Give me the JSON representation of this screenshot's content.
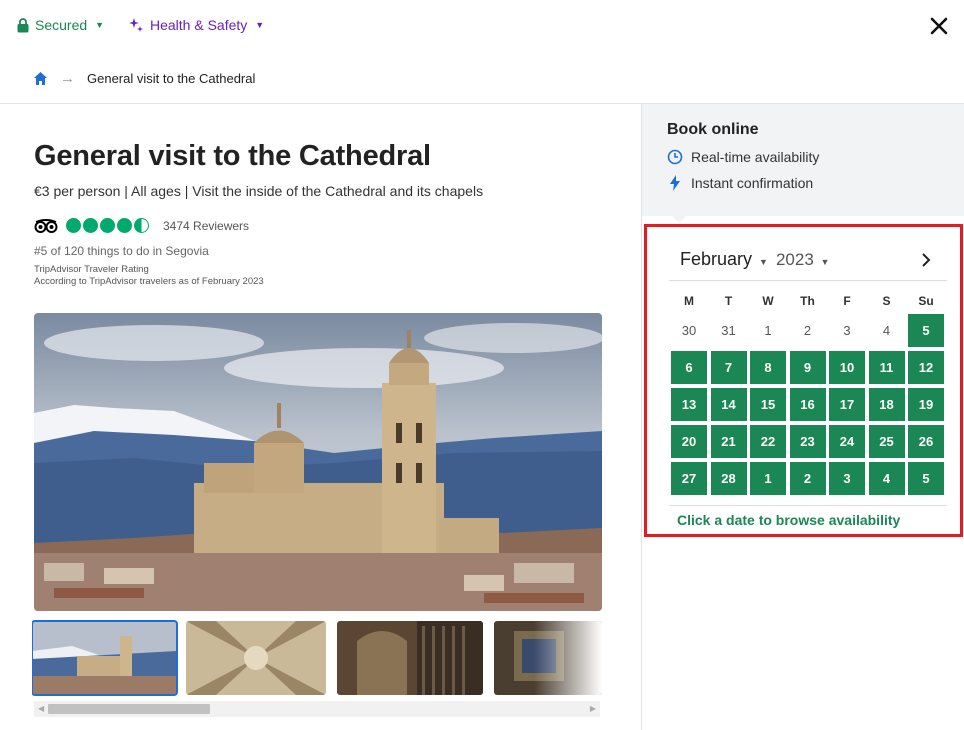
{
  "topbar": {
    "secured_label": "Secured",
    "health_label": "Health & Safety",
    "colors": {
      "secured": "#1a8754",
      "health": "#6a1fc2"
    }
  },
  "breadcrumb": {
    "current": "General visit to the Cathedral"
  },
  "product": {
    "title": "General visit to the Cathedral",
    "subtitle": "€3 per person | All ages | Visit the inside of the Cathedral and its chapels",
    "rating_bubbles": 4.5,
    "reviewers": "3474 Reviewers",
    "rank": "#5 of 120 things to do in Segovia",
    "ta_line1": "TripAdvisor Traveler Rating",
    "ta_line2": "According to TripAdvisor travelers as of February 2023"
  },
  "gallery": {
    "thumbnail_count": 4,
    "selected_index": 0
  },
  "booking": {
    "title": "Book online",
    "feature1": "Real-time availability",
    "feature2": "Instant confirmation"
  },
  "calendar": {
    "month": "February",
    "year": "2023",
    "weekdays": [
      "M",
      "T",
      "W",
      "Th",
      "F",
      "S",
      "Su"
    ],
    "weeks": [
      [
        {
          "d": "30",
          "a": false
        },
        {
          "d": "31",
          "a": false
        },
        {
          "d": "1",
          "a": false
        },
        {
          "d": "2",
          "a": false
        },
        {
          "d": "3",
          "a": false
        },
        {
          "d": "4",
          "a": false
        },
        {
          "d": "5",
          "a": true
        }
      ],
      [
        {
          "d": "6",
          "a": true
        },
        {
          "d": "7",
          "a": true
        },
        {
          "d": "8",
          "a": true
        },
        {
          "d": "9",
          "a": true
        },
        {
          "d": "10",
          "a": true
        },
        {
          "d": "11",
          "a": true
        },
        {
          "d": "12",
          "a": true
        }
      ],
      [
        {
          "d": "13",
          "a": true
        },
        {
          "d": "14",
          "a": true
        },
        {
          "d": "15",
          "a": true
        },
        {
          "d": "16",
          "a": true
        },
        {
          "d": "17",
          "a": true
        },
        {
          "d": "18",
          "a": true
        },
        {
          "d": "19",
          "a": true
        }
      ],
      [
        {
          "d": "20",
          "a": true
        },
        {
          "d": "21",
          "a": true
        },
        {
          "d": "22",
          "a": true
        },
        {
          "d": "23",
          "a": true
        },
        {
          "d": "24",
          "a": true
        },
        {
          "d": "25",
          "a": true
        },
        {
          "d": "26",
          "a": true
        }
      ],
      [
        {
          "d": "27",
          "a": true
        },
        {
          "d": "28",
          "a": true
        },
        {
          "d": "1",
          "a": true
        },
        {
          "d": "2",
          "a": true
        },
        {
          "d": "3",
          "a": true
        },
        {
          "d": "4",
          "a": true
        },
        {
          "d": "5",
          "a": true
        }
      ]
    ],
    "hint": "Click a date to browse availability",
    "available_color": "#1a8754",
    "highlight_border_color": "#e31b23"
  }
}
